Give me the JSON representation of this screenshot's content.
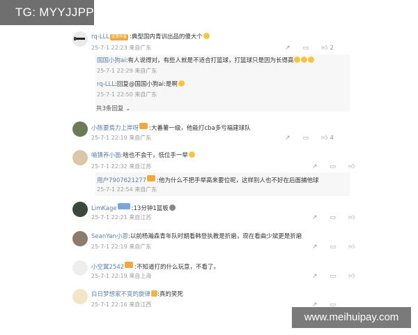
{
  "watermark_top": "TG: MYYJJPP",
  "watermark_bottom": "www.meihuipay.com",
  "comments": [
    {
      "user": "rq-LLL",
      "badge": "优质作者",
      "text": ":典型国内青训出品的傻大个",
      "meta": "25-7-1 22:23 来自广东",
      "likes": "2",
      "replies": [
        {
          "user": "国国小狗ai",
          "text": ":有人说得对，有些人就是不适合打篮球，打篮球只是因为长得高",
          "meta": "25-7-1 22:29 来自广东"
        },
        {
          "user": "rq-LLL",
          "text": ":回复@国国小狗ai:是啊",
          "meta": "25-7-1 22:50 来自广东"
        }
      ],
      "more": "共3条回复"
    },
    {
      "user": "小陈要焉力上岸呀",
      "text": ":大番薯一级，他能打cba多亏福建球队",
      "meta": "25-7-1 22:19 来自广东",
      "likes": "4"
    },
    {
      "user": "喻猜养小面",
      "text": ":啥也不会干，低位手一举",
      "meta": "25-7-1 22:32 来自江苏",
      "replies": [
        {
          "user": "用户7907621277",
          "text": ":他为什么不把手举高来要位呢，这样别人也不好在后面捕他球",
          "meta": "25-7-1 22:54 来自广东"
        }
      ]
    },
    {
      "user": "LimKage",
      "text": ":13分钟1篮板",
      "meta": "25-7-1 22:21 来自江苏"
    },
    {
      "user": "SeanYan小恩",
      "text": ":以前杨瀚森青年队时期看韩登执教是折磨，现在看曲少斌更是折磨",
      "meta": "25-7-1 22:19 来自广东"
    },
    {
      "user": "小空翼2542",
      "text": ":不知道打的什么玩意，不看了。",
      "meta": "25-7-1 22:19 来自上海"
    },
    {
      "user": "白日梦想家不变的旋律",
      "text": ":真的笑死",
      "meta": "25-7-1 22:16 来自江西"
    }
  ],
  "colors": {
    "username": "#5b7ea8",
    "meta": "#9a9a9a",
    "badge": "#f2a93b"
  }
}
